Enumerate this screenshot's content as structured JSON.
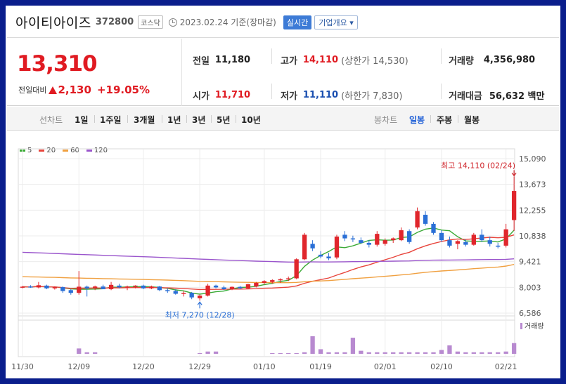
{
  "header": {
    "name": "아이티아이즈",
    "code": "372800",
    "market": "코스닥",
    "base_date": "2023.02.24 기준(장마감)",
    "realtime_label": "실시간",
    "corp_label": "기업개요 ▾"
  },
  "price": {
    "current": "13,310",
    "change_label": "전일대비",
    "change": "2,130",
    "change_pct": "+19.05%",
    "prev_label": "전일",
    "prev": "11,180",
    "open_label": "시가",
    "open": "11,710",
    "high_label": "고가",
    "high": "14,110",
    "upper_limit": "(상한가 14,530)",
    "low_label": "저가",
    "low": "11,110",
    "lower_limit": "(하한가 7,830)",
    "volume_label": "거래량",
    "volume": "4,356,980",
    "amount_label": "거래대금",
    "amount": "56,632 백만"
  },
  "toolbar": {
    "line_chart": "선차트",
    "ranges": [
      "1일",
      "1주일",
      "3개월",
      "1년",
      "3년",
      "5년",
      "10년"
    ],
    "candle_chart": "봉차트",
    "periods": [
      "일봉",
      "주봉",
      "월봉"
    ],
    "active_period": "일봉"
  },
  "chart_data": {
    "type": "candlestick",
    "legend": [
      {
        "name": "5",
        "color": "#3aaa35"
      },
      {
        "name": "20",
        "color": "#e8453c"
      },
      {
        "name": "60",
        "color": "#f0a040"
      },
      {
        "name": "120",
        "color": "#9a55cc"
      }
    ],
    "y_ticks": [
      "15,090",
      "13,673",
      "12,255",
      "10,838",
      "9,421",
      "8,003",
      "6,586"
    ],
    "y_tick_values": [
      15090,
      13673,
      12255,
      10838,
      9421,
      8003,
      6586
    ],
    "x_ticks": [
      "11/30",
      "12/09",
      "12/20",
      "12/29",
      "01/10",
      "01/19",
      "02/01",
      "02/10",
      "02/21"
    ],
    "x_tick_index": [
      0,
      7,
      15,
      22,
      30,
      37,
      45,
      52,
      60
    ],
    "high_annotation": "최고 14,110 (02/24)",
    "low_annotation": "최저 7,270 (12/28)",
    "volume_label": "거래량",
    "candles": [
      [
        8000,
        8080,
        7950,
        8040
      ],
      [
        8050,
        8120,
        7980,
        8010
      ],
      [
        8000,
        8300,
        7950,
        8120
      ],
      [
        8100,
        8150,
        7900,
        7950
      ],
      [
        7950,
        8060,
        7880,
        8020
      ],
      [
        8020,
        8050,
        7700,
        7800
      ],
      [
        7850,
        7900,
        7600,
        7700
      ],
      [
        7700,
        8900,
        7600,
        8040
      ],
      [
        8040,
        8100,
        7500,
        7950
      ],
      [
        7950,
        8100,
        7850,
        8050
      ],
      [
        8050,
        8150,
        7900,
        7900
      ],
      [
        7900,
        8300,
        7850,
        8140
      ],
      [
        8100,
        8200,
        7950,
        8000
      ],
      [
        8000,
        8100,
        7850,
        8050
      ],
      [
        8050,
        8120,
        7950,
        8100
      ],
      [
        8100,
        8150,
        7900,
        7950
      ],
      [
        7950,
        8100,
        7900,
        8050
      ],
      [
        8050,
        8080,
        7800,
        7850
      ],
      [
        7850,
        7950,
        7700,
        7800
      ],
      [
        7800,
        7900,
        7600,
        7650
      ],
      [
        7650,
        7800,
        7500,
        7700
      ],
      [
        7700,
        7750,
        7350,
        7450
      ],
      [
        7400,
        7600,
        7270,
        7550
      ],
      [
        7550,
        8200,
        7500,
        8100
      ],
      [
        8100,
        8150,
        7950,
        8000
      ],
      [
        8000,
        8100,
        7850,
        7900
      ],
      [
        7900,
        8050,
        7850,
        8030
      ],
      [
        8030,
        8080,
        7900,
        7950
      ],
      [
        7950,
        8200,
        7900,
        8180
      ],
      [
        8050,
        8300,
        8000,
        8250
      ],
      [
        8250,
        8400,
        8150,
        8350
      ],
      [
        8300,
        8450,
        8200,
        8400
      ],
      [
        8400,
        8500,
        8250,
        8450
      ],
      [
        8450,
        8600,
        8350,
        8500
      ],
      [
        8500,
        9600,
        8450,
        9550
      ],
      [
        9550,
        11000,
        9500,
        10900
      ],
      [
        10400,
        10600,
        10000,
        10150
      ],
      [
        9800,
        10000,
        9600,
        9700
      ],
      [
        9700,
        9900,
        9500,
        9600
      ],
      [
        9650,
        10900,
        9550,
        10800
      ],
      [
        10900,
        11100,
        10550,
        10700
      ],
      [
        10700,
        10850,
        10500,
        10650
      ],
      [
        10600,
        10750,
        10400,
        10450
      ],
      [
        10450,
        10600,
        10200,
        10350
      ],
      [
        10350,
        11100,
        10250,
        10950
      ],
      [
        10400,
        10700,
        10300,
        10600
      ],
      [
        10600,
        10750,
        10450,
        10700
      ],
      [
        10600,
        11300,
        10550,
        11150
      ],
      [
        11100,
        11200,
        10400,
        10500
      ],
      [
        11300,
        12400,
        11200,
        12200
      ],
      [
        12000,
        12200,
        11400,
        11500
      ],
      [
        11500,
        11600,
        10900,
        11000
      ],
      [
        11000,
        11150,
        10500,
        10600
      ],
      [
        10600,
        10800,
        10200,
        10300
      ],
      [
        10400,
        10600,
        10100,
        10550
      ],
      [
        10500,
        10650,
        10250,
        10350
      ],
      [
        10350,
        11000,
        10300,
        10900
      ],
      [
        10900,
        11200,
        10500,
        10600
      ],
      [
        10600,
        10800,
        10250,
        10400
      ],
      [
        10300,
        10450,
        10150,
        10250
      ],
      [
        10300,
        11500,
        10200,
        11200
      ],
      [
        11710,
        14110,
        11110,
        13310
      ]
    ],
    "volumes": [
      0,
      0,
      0,
      0,
      0,
      0,
      0,
      7,
      2,
      2,
      0,
      0,
      0,
      0,
      0,
      0,
      0,
      0,
      0,
      0,
      0,
      0,
      1,
      3,
      3,
      0,
      0,
      0,
      0,
      0,
      0,
      1,
      1,
      1,
      1,
      2,
      23,
      6,
      2,
      2,
      2,
      21,
      4,
      2,
      2,
      2,
      2,
      2,
      2,
      2,
      2,
      2,
      5,
      11,
      3,
      2,
      2,
      2,
      2,
      2,
      3,
      14,
      44
    ]
  }
}
